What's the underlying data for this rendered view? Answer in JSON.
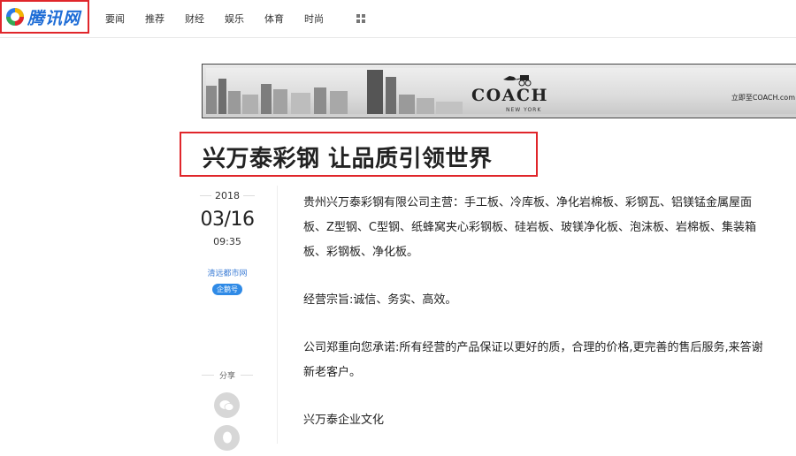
{
  "header": {
    "logo_text": "腾讯网",
    "nav": [
      "要闻",
      "推荐",
      "财经",
      "娱乐",
      "体育",
      "时尚"
    ],
    "more_icon": "grid-icon"
  },
  "ad": {
    "brand": "COACH",
    "sub": "NEW YORK",
    "cta": "立即至COACH.com"
  },
  "article": {
    "title": "兴万泰彩钢 让品质引领世界",
    "year": "2018",
    "date": "03/16",
    "time": "09:35",
    "source": "清远都市网",
    "badge": "企鹅号",
    "share_label": "分享",
    "paragraphs": [
      "贵州兴万泰彩钢有限公司主营：手工板、冷库板、净化岩棉板、彩钢瓦、铝镁锰金属屋面板、Z型钢、C型钢、纸蜂窝夹心彩钢板、硅岩板、玻镁净化板、泡沫板、岩棉板、集装箱板、彩钢板、净化板。",
      "经营宗旨:诚信、务实、高效。",
      "公司郑重向您承诺:所有经营的产品保证以更好的质，合理的价格,更完善的售后服务,来答谢新老客户。",
      "兴万泰企业文化"
    ]
  },
  "colors": {
    "highlight_red": "#e0262b",
    "brand_blue": "#1d6cd6",
    "badge_blue": "#2f8ae6"
  }
}
